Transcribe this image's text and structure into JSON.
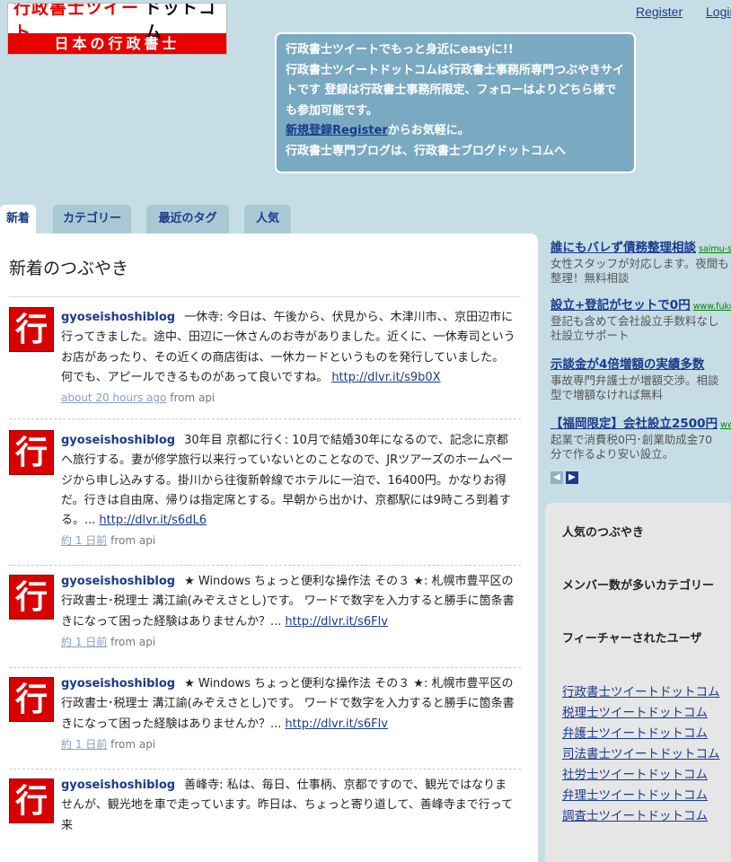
{
  "logo": {
    "top_red": "行政書士ツイート",
    "top_black": "ドットコム",
    "bottom": "日本の行政書士"
  },
  "header": {
    "register_label": "Register",
    "login_label": "Login"
  },
  "info_box": {
    "line1": "行政書士ツイートでもっと身近にeasyに!!",
    "line2": "行政書士ツイートドットコムは行政書士事務所専門つぶやきサイトです 登録は行政書士事務所限定、フォローはよりどちら様でも参加可能です。",
    "register_link": "新規登録Register",
    "register_suffix": "からお気軽に。",
    "line4": "行政書士専門ブログは、行政書士ブログドットコムへ"
  },
  "tabs": [
    {
      "label": "新着"
    },
    {
      "label": "カテゴリー"
    },
    {
      "label": "最近のタグ"
    },
    {
      "label": "人気"
    }
  ],
  "main": {
    "title": "新着のつぶやき",
    "avatar_glyph": "行",
    "tweets": [
      {
        "user": "gyoseishoshiblog",
        "text": "一休寺: 今日は、午後から、伏見から、木津川市、、京田辺市に行ってきました。途中、田辺に一休さんのお寺がありました。近くに、一休寿司というお店があったり、その近くの商店街は、一休カードというものを発行していました。何でも、アピールできるものがあって良いですね。",
        "link": "http://dlvr.it/s9b0X",
        "time": "about 20 hours ago",
        "from": "from api"
      },
      {
        "user": "gyoseishoshiblog",
        "text": "30年目 京都に行く: 10月で結婚30年になるので、記念に京都へ旅行する。妻が修学旅行以来行っていないとのことなので、JRツアーズのホームページから申し込みする。掛川から往復新幹線でホテルに一泊で、16400円。かなりお得だ。行きは自由席、帰りは指定席とする。早朝から出かけ、京都駅には9時ころ到着する。...",
        "link": "http://dlvr.it/s6dL6",
        "time": "約 1 日前",
        "from": "from api"
      },
      {
        "user": "gyoseishoshiblog",
        "text": "★ Windows ちょっと便利な操作法 その３ ★: 札幌市豊平区の 行政書士･税理士 溝江諭(みぞえさとし)です。 ワードで数字を入力すると勝手に箇条書きになって困った経験はありませんか？...",
        "link": "http://dlvr.it/s6Flv",
        "time": "約 1 日前",
        "from": "from api"
      },
      {
        "user": "gyoseishoshiblog",
        "text": "★ Windows ちょっと便利な操作法 その３ ★: 札幌市豊平区の 行政書士･税理士 溝江諭(みぞえさとし)です。 ワードで数字を入力すると勝手に箇条書きになって困った経験はありませんか？...",
        "link": "http://dlvr.it/s6Flv",
        "time": "約 1 日前",
        "from": "from api"
      },
      {
        "user": "gyoseishoshiblog",
        "text": "善峰寺: 私は、毎日、仕事柄、京都ですので、観光ではなりませんが、観光地を車で走っています。昨日は、ちょっと寄り道して、善峰寺まで行って来",
        "link": "",
        "time": "",
        "from": ""
      }
    ]
  },
  "ads": [
    {
      "title": "誰にもバレず債務整理相談",
      "url": "saimu-s",
      "desc1": "女性スタッフが対応します。夜間も",
      "desc2": "整理！無料相談"
    },
    {
      "title": "設立+登記がセットで0円",
      "url": "www.fukuc",
      "desc1": "登記も含めて会社設立手数料なし",
      "desc2": "社設立サポート"
    },
    {
      "title": "示談金が4倍増額の実績多数",
      "url": "",
      "desc1": "事故専門弁護士が増額交渉。相談",
      "desc2": "型で増額なければ無料"
    },
    {
      "title": "【福岡限定】会社設立2500円",
      "url": "www.",
      "desc1": "起業で消費税0円･創業助成金70",
      "desc2": "分で作るより安い設立。"
    }
  ],
  "ad_nav": {
    "prev": "◀",
    "next": "▶"
  },
  "sidebar": {
    "heading_popular": "人気のつぶやき",
    "heading_categories": "メンバー数が多いカテゴリー",
    "heading_featured": "フィーチャーされたユーザ",
    "links": [
      "行政書士ツイートドットコム",
      "税理士ツイートドットコム",
      "弁護士ツイートドットコム",
      "司法書士ツイートドットコム",
      "社労士ツイートドットコム",
      "弁理士ツイートドットコム",
      "調査士ツイートドットコム"
    ]
  },
  "colors": {
    "background": "#c6dde6",
    "link": "#1a3b8c",
    "brand_red": "#e60000",
    "info_box": "#7aaac2"
  }
}
